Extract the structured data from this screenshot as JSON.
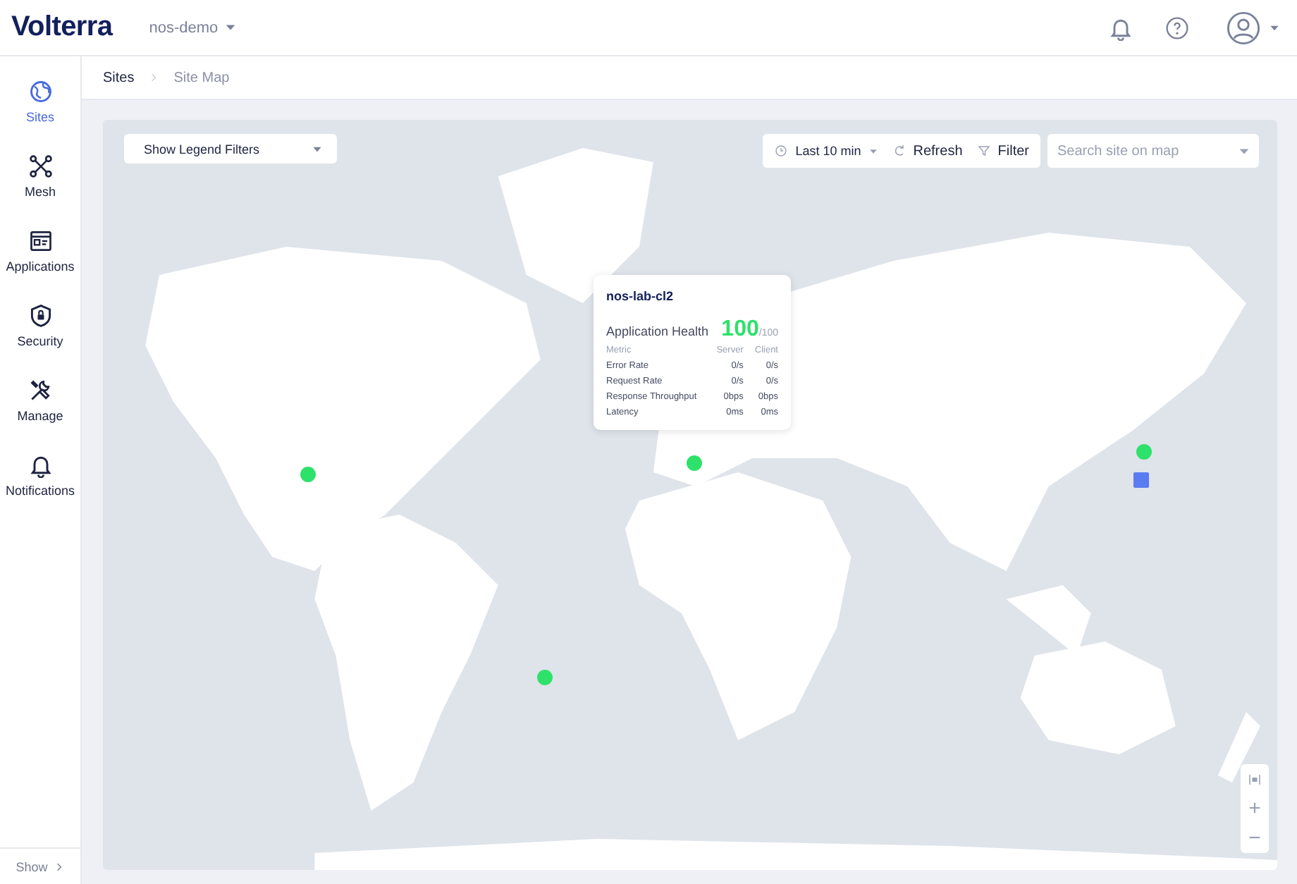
{
  "header": {
    "logo": "Volterra",
    "namespace": "nos-demo"
  },
  "sidebar": {
    "items": [
      {
        "label": "Sites",
        "selected": true
      },
      {
        "label": "Mesh",
        "selected": false
      },
      {
        "label": "Applications",
        "selected": false
      },
      {
        "label": "Security",
        "selected": false
      },
      {
        "label": "Manage",
        "selected": false
      },
      {
        "label": "Notifications",
        "selected": false
      }
    ],
    "footer": "Show"
  },
  "breadcrumb": [
    "Sites",
    "Site Map"
  ],
  "map": {
    "legend_filter": "Show Legend Filters",
    "time_range": "Last 10 min",
    "refresh": "Refresh",
    "filter": "Filter",
    "search": {
      "placeholder": "Search site on map"
    },
    "markers": [
      {
        "kind": "dot",
        "color": "#2ee16b"
      },
      {
        "kind": "dot",
        "color": "#2ee16b"
      },
      {
        "kind": "dot",
        "color": "#2ee16b"
      },
      {
        "kind": "dot",
        "color": "#2ee16b"
      },
      {
        "kind": "square",
        "color": "#5b7cf0"
      }
    ],
    "tooltip": {
      "title": "nos-lab-cl2",
      "health_label": "Application Health",
      "health": "100",
      "health_max": "/100",
      "columns": [
        "Metric",
        "Server",
        "Client"
      ],
      "rows": [
        [
          "Error Rate",
          "0/s",
          "0/s"
        ],
        [
          "Request Rate",
          "0/s",
          "0/s"
        ],
        [
          "Response Throughput",
          "0bps",
          "0bps"
        ],
        [
          "Latency",
          "0ms",
          "0ms"
        ]
      ]
    },
    "zoom": {
      "in": "+",
      "out": "−"
    }
  }
}
